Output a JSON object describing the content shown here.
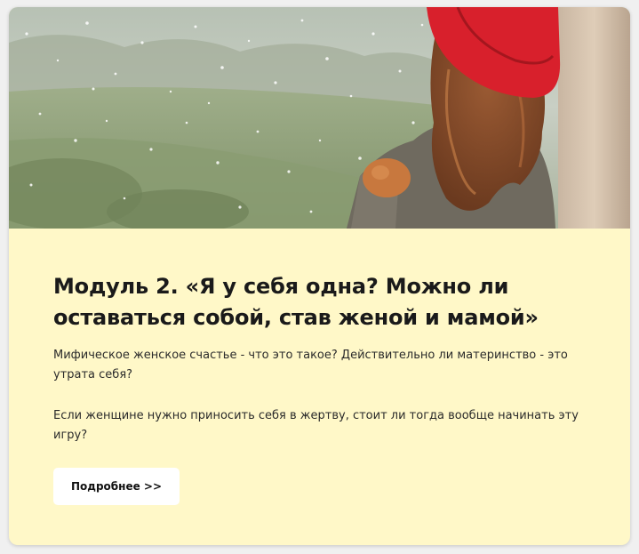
{
  "module": {
    "title": "Модуль 2. «Я у себя одна? Можно ли оставаться собой, став женой и мамой»",
    "description_1": "Мифическое женское счастье - что это такое? Действительно ли материнство - это утрата себя?",
    "description_2": "Если женщине нужно приносить себя в жертву, стоит ли тогда вообще начинать эту игру?",
    "button_label": "Подробнее >>"
  },
  "colors": {
    "card_background": "#fff8c8",
    "button_background": "#ffffff",
    "hat": "#d8202c"
  }
}
